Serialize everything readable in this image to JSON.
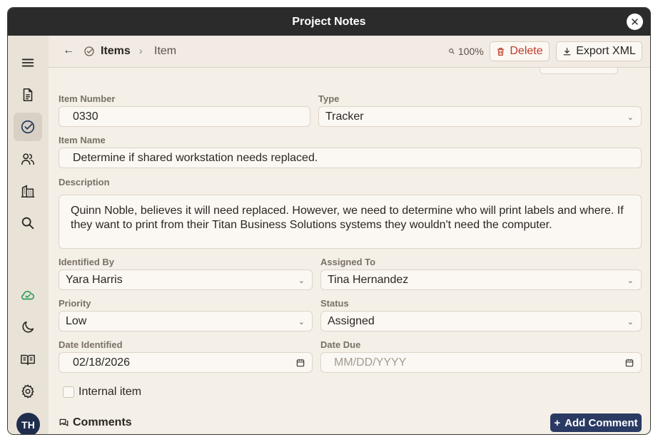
{
  "window": {
    "title": "Project Notes"
  },
  "sidebar": {
    "items": [
      {
        "name": "menu"
      },
      {
        "name": "documents"
      },
      {
        "name": "items",
        "active": true
      },
      {
        "name": "people"
      },
      {
        "name": "organizations"
      },
      {
        "name": "search"
      },
      {
        "name": "sync"
      },
      {
        "name": "dark-mode"
      },
      {
        "name": "help"
      },
      {
        "name": "settings"
      }
    ],
    "avatar_initials": "TH"
  },
  "toolbar": {
    "back_symbol": "←",
    "breadcrumb_parent": "Items",
    "breadcrumb_separator": "›",
    "breadcrumb_current": "Item",
    "zoom": "100%",
    "delete_label": "Delete",
    "export_label": "Export XML"
  },
  "form": {
    "item_number": {
      "label": "Item Number",
      "value": "0330"
    },
    "type": {
      "label": "Type",
      "value": "Tracker"
    },
    "item_name": {
      "label": "Item Name",
      "value": "Determine if shared workstation needs replaced."
    },
    "description": {
      "label": "Description",
      "value": "Quinn Noble, believes it will need replaced. However, we need to determine who will print labels and where. If they want to print from their Titan Business Solutions systems they wouldn't need the computer."
    },
    "identified_by": {
      "label": "Identified By",
      "value": "Yara Harris"
    },
    "assigned_to": {
      "label": "Assigned To",
      "value": "Tina Hernandez"
    },
    "priority": {
      "label": "Priority",
      "value": "Low"
    },
    "status": {
      "label": "Status",
      "value": "Assigned"
    },
    "date_identified": {
      "label": "Date Identified",
      "value": "02/18/2026"
    },
    "date_due": {
      "label": "Date Due",
      "placeholder": "MM/DD/YYYY"
    },
    "internal_item": {
      "label": "Internal item",
      "checked": false
    }
  },
  "comments": {
    "title": "Comments",
    "add_label": "Add Comment",
    "add_symbol": "+"
  },
  "colors": {
    "accent": "#2a3a63",
    "danger": "#c0392b",
    "titlebar": "#2b2b2b",
    "sidebar": "#e9e2d7"
  }
}
